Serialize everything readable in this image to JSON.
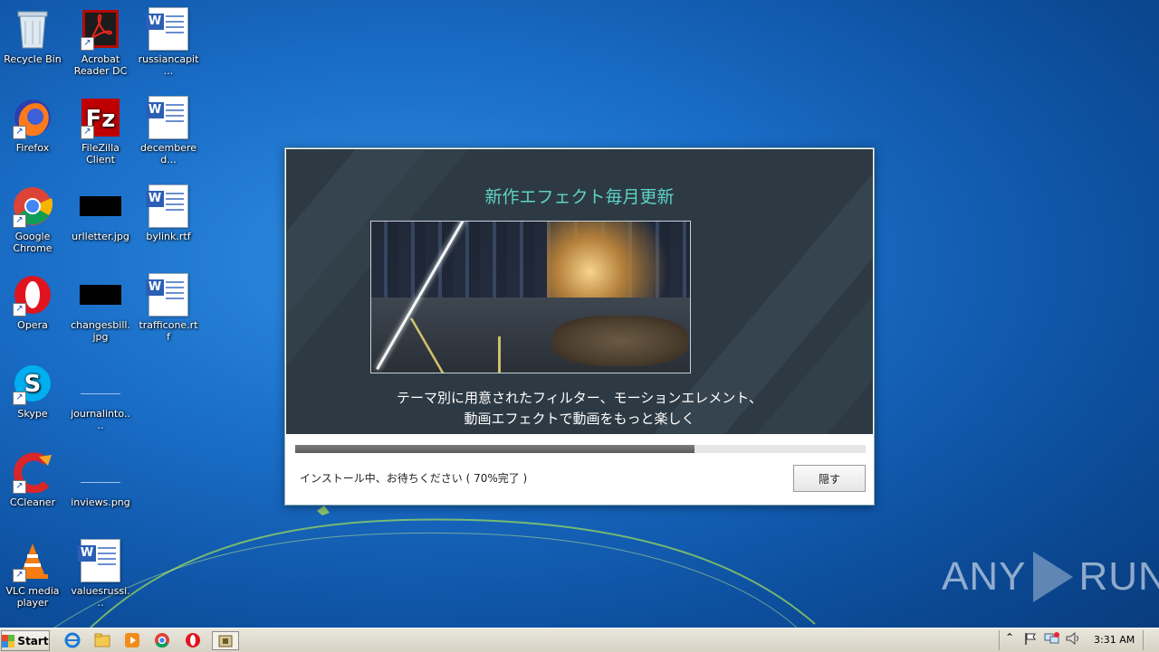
{
  "desktop": {
    "icons": [
      {
        "label": "Recycle Bin"
      },
      {
        "label": "Acrobat Reader DC"
      },
      {
        "label": "russiancapit..."
      },
      {
        "label": "Firefox"
      },
      {
        "label": "FileZilla Client"
      },
      {
        "label": "decembered..."
      },
      {
        "label": "Google Chrome"
      },
      {
        "label": "urlletter.jpg"
      },
      {
        "label": "bylink.rtf"
      },
      {
        "label": "Opera"
      },
      {
        "label": "changesbill.jpg"
      },
      {
        "label": "trafficone.rtf"
      },
      {
        "label": "Skype"
      },
      {
        "label": "journalinto...."
      },
      {
        "label": "CCleaner"
      },
      {
        "label": "inviews.png"
      },
      {
        "label": "VLC media player"
      },
      {
        "label": "valuesrussi..."
      }
    ]
  },
  "installer": {
    "headline": "新作エフェクト毎月更新",
    "caption_line1": "テーマ別に用意されたフィルター、モーションエレメント、",
    "caption_line2": "動画エフェクトで動画をもっと楽しく",
    "progress_percent": 70,
    "status_text": "インストール中、お待ちください ( 70%完了 )",
    "hide_button": "隠す"
  },
  "watermark": {
    "left": "ANY",
    "right": "RUN"
  },
  "taskbar": {
    "start_label": "Start",
    "clock": "3:31 AM"
  },
  "colors": {
    "accent_teal": "#5fd3c5",
    "banner_bg": "#2d3a44"
  }
}
